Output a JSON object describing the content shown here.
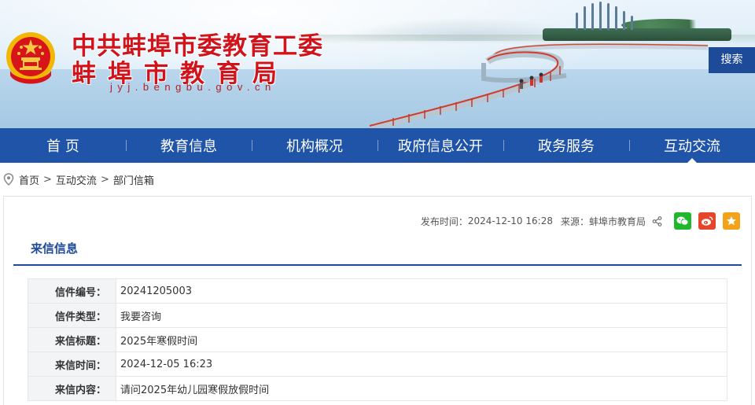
{
  "header": {
    "title_line1": "中共蚌埠市委教育工委",
    "title_line2": "蚌埠市教育局",
    "domain": "jyj.bengbu.gov.cn",
    "search_label": "搜索"
  },
  "nav": {
    "items": [
      {
        "label": "首 页"
      },
      {
        "label": "教育信息"
      },
      {
        "label": "机构概况"
      },
      {
        "label": "政府信息公开"
      },
      {
        "label": "政务服务"
      },
      {
        "label": "互动交流"
      }
    ],
    "active_index": 5
  },
  "breadcrumb": {
    "items": [
      "首页",
      "互动交流",
      "部门信箱"
    ],
    "separator": ">"
  },
  "meta": {
    "publish_label": "发布时间：",
    "publish_time": "2024-12-10 16:28",
    "source_label": "来源：",
    "source": "蚌埠市教育局"
  },
  "section": {
    "title": "来信信息"
  },
  "letter": {
    "rows": [
      {
        "label": "信件编号：",
        "value": "20241205003"
      },
      {
        "label": "信件类型：",
        "value": "我要咨询"
      },
      {
        "label": "来信标题：",
        "value": "2025年寒假时间"
      },
      {
        "label": "来信时间：",
        "value": "2024-12-05 16:23"
      },
      {
        "label": "来信内容：",
        "value": "请问2025年幼儿园寒假放假时间"
      }
    ]
  },
  "colors": {
    "nav_bg": "#1f54a8",
    "title_red": "#d1141c",
    "accent_blue": "#1e4a9a",
    "wechat": "#21b72c",
    "weibo": "#e6452c",
    "favorite": "#f2a31b"
  },
  "icons": [
    "national-emblem-icon",
    "location-pin-icon",
    "share-icon",
    "wechat-icon",
    "weibo-icon",
    "favorite-icon"
  ]
}
